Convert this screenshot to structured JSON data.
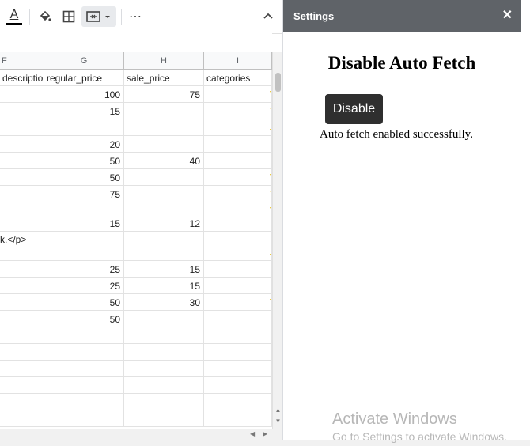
{
  "toolbar": {
    "text_color_letter": "A",
    "more_label": "⋯"
  },
  "sheet": {
    "columns": [
      {
        "id": "F",
        "label": "F"
      },
      {
        "id": "G",
        "label": "G"
      },
      {
        "id": "H",
        "label": "H"
      },
      {
        "id": "I",
        "label": "I"
      }
    ],
    "header_row": [
      "descriptio",
      "regular_price",
      "sale_price",
      "categories"
    ],
    "rows": [
      {
        "f": "",
        "g": "100",
        "h": "75"
      },
      {
        "f": "",
        "g": "15",
        "h": ""
      },
      {
        "f": "",
        "g": "",
        "h": ""
      },
      {
        "f": "",
        "g": "20",
        "h": ""
      },
      {
        "f": "",
        "g": "50",
        "h": "40"
      },
      {
        "f": "",
        "g": "50",
        "h": ""
      },
      {
        "f": "",
        "g": "75",
        "h": ""
      },
      {
        "f": "",
        "g": "15",
        "h": "12"
      },
      {
        "f": "k.</p>",
        "g": "",
        "h": ""
      },
      {
        "f": "",
        "g": "25",
        "h": "15"
      },
      {
        "f": "",
        "g": "25",
        "h": "15"
      },
      {
        "f": "",
        "g": "50",
        "h": "30"
      },
      {
        "f": "",
        "g": "50",
        "h": ""
      },
      {
        "f": "",
        "g": "",
        "h": ""
      },
      {
        "f": "",
        "g": "",
        "h": ""
      },
      {
        "f": "",
        "g": "",
        "h": ""
      },
      {
        "f": "",
        "g": "",
        "h": ""
      },
      {
        "f": "",
        "g": "",
        "h": ""
      },
      {
        "f": "",
        "g": "",
        "h": ""
      }
    ]
  },
  "panel": {
    "title": "Settings",
    "close": "✕",
    "heading": "Disable Auto Fetch",
    "button_label": "Disable",
    "status": "Auto fetch enabled successfully."
  },
  "watermark": {
    "line1": "Activate Windows",
    "line2": "Go to Settings to activate Windows."
  },
  "colors": {
    "panel_header": "#5f6368",
    "button": "#2f2f2f",
    "note_marker": "#e6b800"
  }
}
